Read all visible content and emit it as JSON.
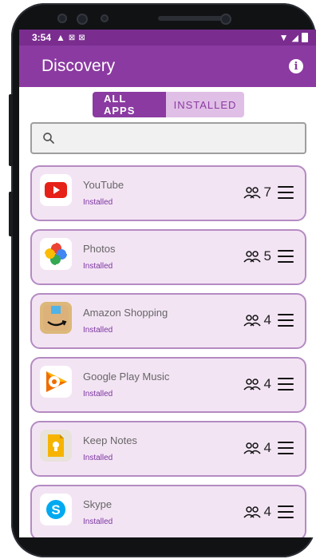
{
  "status_bar": {
    "time": "3:54",
    "left_icons": [
      "warning-icon",
      "sim-icon",
      "card-icon"
    ],
    "right_icons": [
      "wifi-icon",
      "signal-icon",
      "battery-icon"
    ]
  },
  "app_bar": {
    "title": "Discovery",
    "info_icon": "info-icon"
  },
  "tabs": [
    {
      "label": "ALL APPS",
      "selected": true
    },
    {
      "label": "INSTALLED",
      "selected": false
    }
  ],
  "search": {
    "placeholder": "",
    "value": ""
  },
  "apps": [
    {
      "name": "YouTube",
      "status": "Installed",
      "users": "7",
      "icon": "youtube-icon"
    },
    {
      "name": "Photos",
      "status": "Installed",
      "users": "5",
      "icon": "photos-icon"
    },
    {
      "name": "Amazon Shopping",
      "status": "Installed",
      "users": "4",
      "icon": "amazon-icon"
    },
    {
      "name": "Google Play Music",
      "status": "Installed",
      "users": "4",
      "icon": "play-music-icon"
    },
    {
      "name": "Keep Notes",
      "status": "Installed",
      "users": "4",
      "icon": "keep-notes-icon"
    },
    {
      "name": "Skype",
      "status": "Installed",
      "users": "4",
      "icon": "skype-icon"
    }
  ],
  "colors": {
    "primary": "#8b3aa1",
    "status_bar": "#7a2d8f",
    "card_bg": "#f3e4f4",
    "card_border": "#b48bc2"
  }
}
